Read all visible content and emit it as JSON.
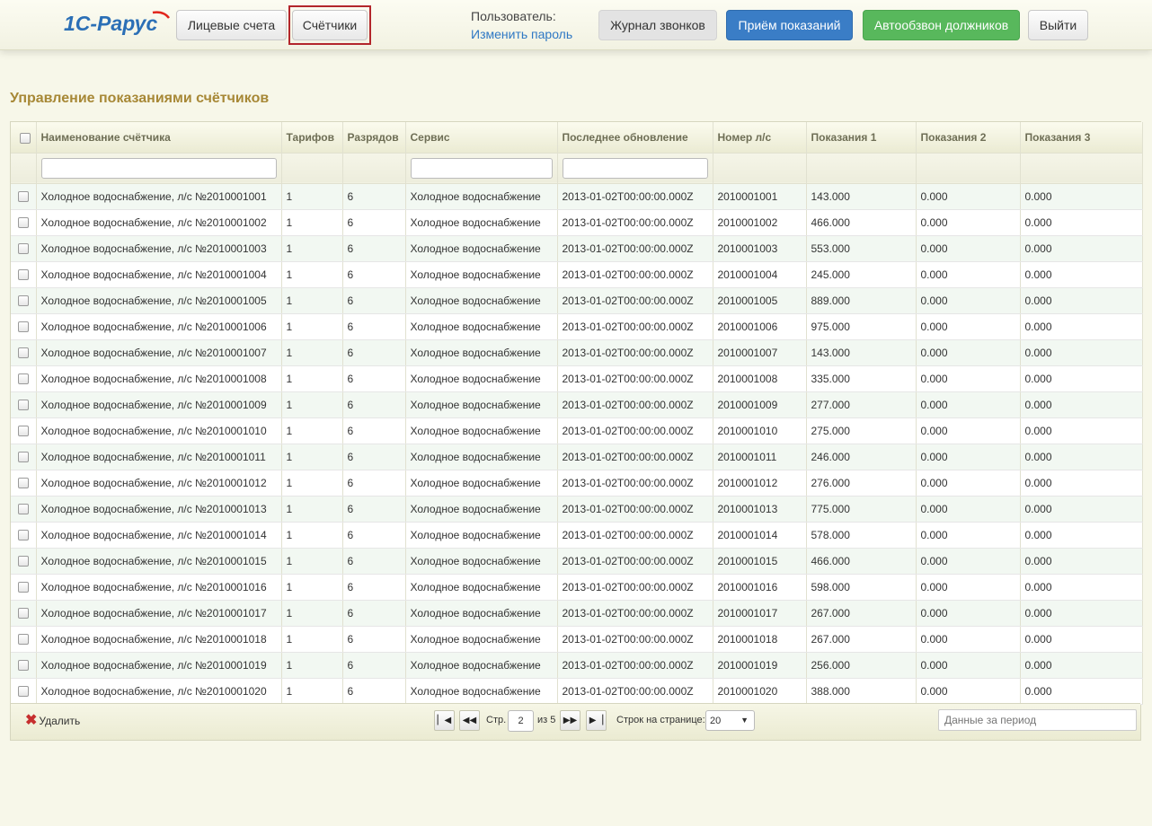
{
  "header": {
    "logo_text": "1С-Рарус",
    "tabs": [
      "Лицевые счета",
      "Счётчики"
    ],
    "user_label": "Пользователь:",
    "change_password": "Изменить пароль",
    "buttons": {
      "call_log": "Журнал звонков",
      "receive_readings": "Приём показаний",
      "autodial_debtors": "Автообзвон должников",
      "logout": "Выйти"
    },
    "colors": {
      "blue": "#3a7dc6",
      "green": "#58b85c",
      "active_outline": "#b3262b"
    }
  },
  "page_title": "Управление показаниями счётчиков",
  "table": {
    "columns": [
      "Наименование счётчика",
      "Тарифов",
      "Разрядов",
      "Сервис",
      "Последнее обновление",
      "Номер л/с",
      "Показания 1",
      "Показания 2",
      "Показания 3"
    ],
    "rows": [
      [
        "Холодное водоснабжение, л/с №2010001001",
        "1",
        "6",
        "Холодное водоснабжение",
        "2013-01-02T00:00:00.000Z",
        "2010001001",
        "143.000",
        "0.000",
        "0.000"
      ],
      [
        "Холодное водоснабжение, л/с №2010001002",
        "1",
        "6",
        "Холодное водоснабжение",
        "2013-01-02T00:00:00.000Z",
        "2010001002",
        "466.000",
        "0.000",
        "0.000"
      ],
      [
        "Холодное водоснабжение, л/с №2010001003",
        "1",
        "6",
        "Холодное водоснабжение",
        "2013-01-02T00:00:00.000Z",
        "2010001003",
        "553.000",
        "0.000",
        "0.000"
      ],
      [
        "Холодное водоснабжение, л/с №2010001004",
        "1",
        "6",
        "Холодное водоснабжение",
        "2013-01-02T00:00:00.000Z",
        "2010001004",
        "245.000",
        "0.000",
        "0.000"
      ],
      [
        "Холодное водоснабжение, л/с №2010001005",
        "1",
        "6",
        "Холодное водоснабжение",
        "2013-01-02T00:00:00.000Z",
        "2010001005",
        "889.000",
        "0.000",
        "0.000"
      ],
      [
        "Холодное водоснабжение, л/с №2010001006",
        "1",
        "6",
        "Холодное водоснабжение",
        "2013-01-02T00:00:00.000Z",
        "2010001006",
        "975.000",
        "0.000",
        "0.000"
      ],
      [
        "Холодное водоснабжение, л/с №2010001007",
        "1",
        "6",
        "Холодное водоснабжение",
        "2013-01-02T00:00:00.000Z",
        "2010001007",
        "143.000",
        "0.000",
        "0.000"
      ],
      [
        "Холодное водоснабжение, л/с №2010001008",
        "1",
        "6",
        "Холодное водоснабжение",
        "2013-01-02T00:00:00.000Z",
        "2010001008",
        "335.000",
        "0.000",
        "0.000"
      ],
      [
        "Холодное водоснабжение, л/с №2010001009",
        "1",
        "6",
        "Холодное водоснабжение",
        "2013-01-02T00:00:00.000Z",
        "2010001009",
        "277.000",
        "0.000",
        "0.000"
      ],
      [
        "Холодное водоснабжение, л/с №2010001010",
        "1",
        "6",
        "Холодное водоснабжение",
        "2013-01-02T00:00:00.000Z",
        "2010001010",
        "275.000",
        "0.000",
        "0.000"
      ],
      [
        "Холодное водоснабжение, л/с №2010001011",
        "1",
        "6",
        "Холодное водоснабжение",
        "2013-01-02T00:00:00.000Z",
        "2010001011",
        "246.000",
        "0.000",
        "0.000"
      ],
      [
        "Холодное водоснабжение, л/с №2010001012",
        "1",
        "6",
        "Холодное водоснабжение",
        "2013-01-02T00:00:00.000Z",
        "2010001012",
        "276.000",
        "0.000",
        "0.000"
      ],
      [
        "Холодное водоснабжение, л/с №2010001013",
        "1",
        "6",
        "Холодное водоснабжение",
        "2013-01-02T00:00:00.000Z",
        "2010001013",
        "775.000",
        "0.000",
        "0.000"
      ],
      [
        "Холодное водоснабжение, л/с №2010001014",
        "1",
        "6",
        "Холодное водоснабжение",
        "2013-01-02T00:00:00.000Z",
        "2010001014",
        "578.000",
        "0.000",
        "0.000"
      ],
      [
        "Холодное водоснабжение, л/с №2010001015",
        "1",
        "6",
        "Холодное водоснабжение",
        "2013-01-02T00:00:00.000Z",
        "2010001015",
        "466.000",
        "0.000",
        "0.000"
      ],
      [
        "Холодное водоснабжение, л/с №2010001016",
        "1",
        "6",
        "Холодное водоснабжение",
        "2013-01-02T00:00:00.000Z",
        "2010001016",
        "598.000",
        "0.000",
        "0.000"
      ],
      [
        "Холодное водоснабжение, л/с №2010001017",
        "1",
        "6",
        "Холодное водоснабжение",
        "2013-01-02T00:00:00.000Z",
        "2010001017",
        "267.000",
        "0.000",
        "0.000"
      ],
      [
        "Холодное водоснабжение, л/с №2010001018",
        "1",
        "6",
        "Холодное водоснабжение",
        "2013-01-02T00:00:00.000Z",
        "2010001018",
        "267.000",
        "0.000",
        "0.000"
      ],
      [
        "Холодное водоснабжение, л/с №2010001019",
        "1",
        "6",
        "Холодное водоснабжение",
        "2013-01-02T00:00:00.000Z",
        "2010001019",
        "256.000",
        "0.000",
        "0.000"
      ],
      [
        "Холодное водоснабжение, л/с №2010001020",
        "1",
        "6",
        "Холодное водоснабжение",
        "2013-01-02T00:00:00.000Z",
        "2010001020",
        "388.000",
        "0.000",
        "0.000"
      ]
    ]
  },
  "pager": {
    "delete_label": "Удалить",
    "page_label": "Стр.",
    "current_page": "2",
    "of_label": "из 5",
    "rows_label": "Строк на странице:",
    "rows_value": "20",
    "period_placeholder": "Данные за период"
  }
}
